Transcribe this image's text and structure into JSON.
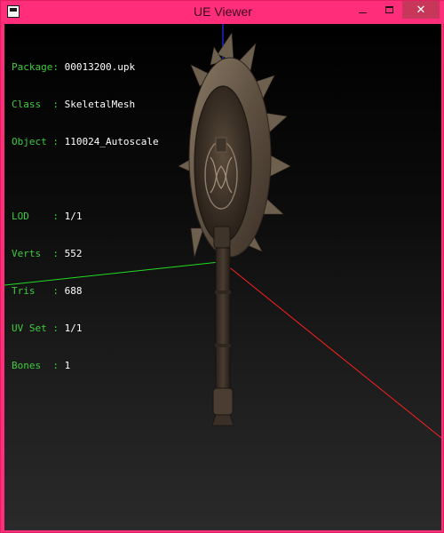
{
  "window": {
    "title": "UE Viewer",
    "controls": {
      "minimize": "minimize",
      "maximize": "maximize",
      "close": "close"
    }
  },
  "info": {
    "package": {
      "label": "Package:",
      "value": "00013200.upk"
    },
    "class": {
      "label": "Class  :",
      "value": "SkeletalMesh"
    },
    "object": {
      "label": "Object :",
      "value": "110024_Autoscale"
    },
    "lod": {
      "label": "LOD    :",
      "value": "1/1"
    },
    "verts": {
      "label": "Verts  :",
      "value": "552"
    },
    "tris": {
      "label": "Tris   :",
      "value": "688"
    },
    "uvset": {
      "label": "UV Set :",
      "value": "1/1"
    },
    "bones": {
      "label": "Bones  :",
      "value": "1"
    }
  },
  "colors": {
    "titlebar": "#ff2d7a",
    "close_button": "#c7375a",
    "axis_x": "#ff2020",
    "axis_y": "#22dd22",
    "axis_z": "#2233ff",
    "info_label": "#3ecb3e",
    "info_value": "#ffffff"
  },
  "scene": {
    "object": "mace-mesh",
    "axes": [
      "x-axis",
      "y-axis",
      "z-axis"
    ]
  }
}
